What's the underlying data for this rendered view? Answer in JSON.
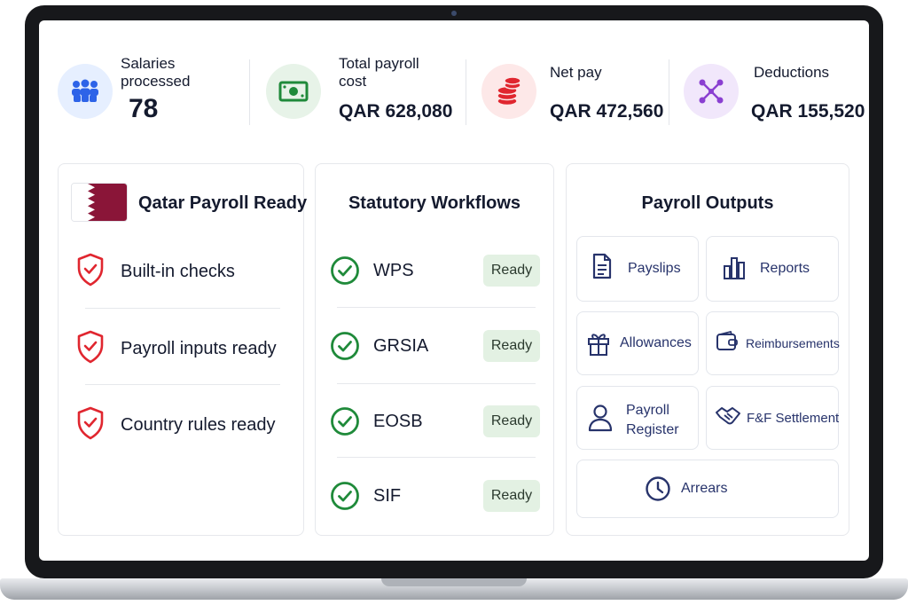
{
  "stats": [
    {
      "label_line1": "Salaries",
      "label_line2": "processed",
      "value": "78",
      "icon": "people-icon",
      "icon_bg": "#e6efff"
    },
    {
      "label_line1": "Total payroll",
      "label_line2": "cost",
      "value": "QAR 628,080",
      "icon": "banknote-icon",
      "icon_bg": "#e7f3e8"
    },
    {
      "label_line1": "Net pay",
      "value": "QAR 472,560",
      "icon": "coins-icon",
      "icon_bg": "#fde8e8"
    },
    {
      "label_line1": "Deductions",
      "value": "QAR 155,520",
      "icon": "network-icon",
      "icon_bg": "#f1e7fb"
    }
  ],
  "qatar_card": {
    "title": "Qatar Payroll Ready",
    "items": [
      "Built-in checks",
      "Payroll inputs ready",
      "Country rules ready"
    ]
  },
  "workflows_card": {
    "title": "Statutory Workflows",
    "items": [
      {
        "name": "WPS",
        "status": "Ready"
      },
      {
        "name": "GRSIA",
        "status": "Ready"
      },
      {
        "name": "EOSB",
        "status": "Ready"
      },
      {
        "name": "SIF",
        "status": "Ready"
      }
    ]
  },
  "outputs_card": {
    "title": "Payroll Outputs",
    "tiles": {
      "payslips": "Payslips",
      "reports": "Reports",
      "allowances": "Allowances",
      "reimbursements": "Reimbursements",
      "payroll_register_line1": "Payroll",
      "payroll_register_line2": "Register",
      "ff_settlement": "F&F Settlement",
      "arrears": "Arrears"
    }
  },
  "colors": {
    "accent_blue": "#2d63e8",
    "accent_green": "#1f8a3a",
    "accent_red": "#e0262f",
    "accent_purple": "#8a3fd1",
    "navy": "#27336b",
    "qatar_maroon": "#8a1538"
  }
}
